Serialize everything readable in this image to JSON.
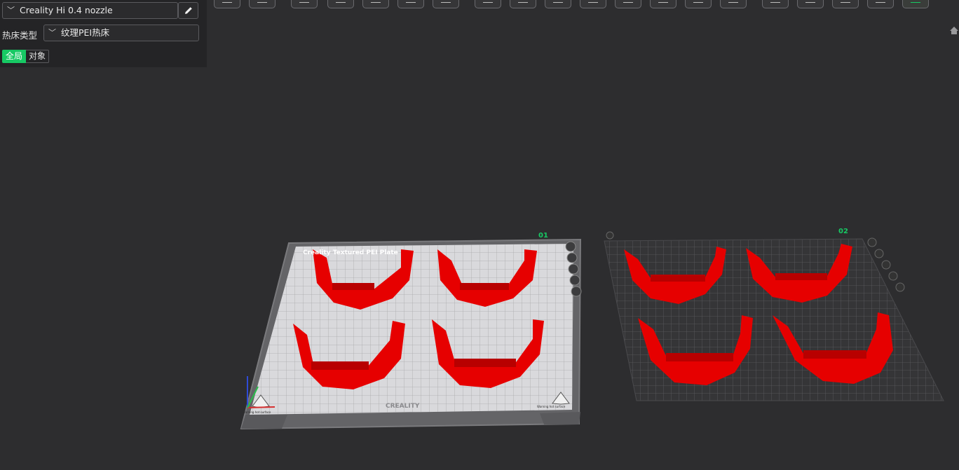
{
  "panel": {
    "printer": "Creality Hi 0.4 nozzle",
    "bed_label": "热床类型",
    "bed_value": "纹理PEI热床",
    "tabs": {
      "global": "全局",
      "object": "对象"
    },
    "chevron": "﹀"
  },
  "toolbar": {
    "tools": [
      {
        "icon": "add-object-icon"
      },
      {
        "icon": "grid-icon"
      },
      {
        "icon": "auto-orient-icon"
      },
      {
        "icon": "arrange-icon"
      },
      {
        "icon": "lay-on-face-icon"
      },
      {
        "icon": "split-icon"
      },
      {
        "icon": "slice-plate-icon"
      },
      {
        "icon": "columns-icon"
      },
      {
        "icon": "settings-cogs-icon"
      },
      {
        "icon": "measure-icon"
      },
      {
        "icon": "cube-icon"
      },
      {
        "icon": "edit-icon"
      },
      {
        "icon": "cut-icon"
      },
      {
        "icon": "hollow-icon"
      },
      {
        "icon": "support-icon"
      },
      {
        "icon": "tower-icon"
      },
      {
        "icon": "paint-icon"
      },
      {
        "icon": "seam-icon"
      },
      {
        "icon": "circle-icon"
      },
      {
        "icon": "text-tool-icon",
        "active": true
      }
    ]
  },
  "viewport": {
    "plate1": {
      "number": "01",
      "title": "Creality Textured PEI Plate",
      "brand": "CREALITY",
      "warning": "Warning hot surface"
    },
    "plate2": {
      "number": "02"
    },
    "model_color": "#e60000",
    "accent": "#17c964"
  }
}
